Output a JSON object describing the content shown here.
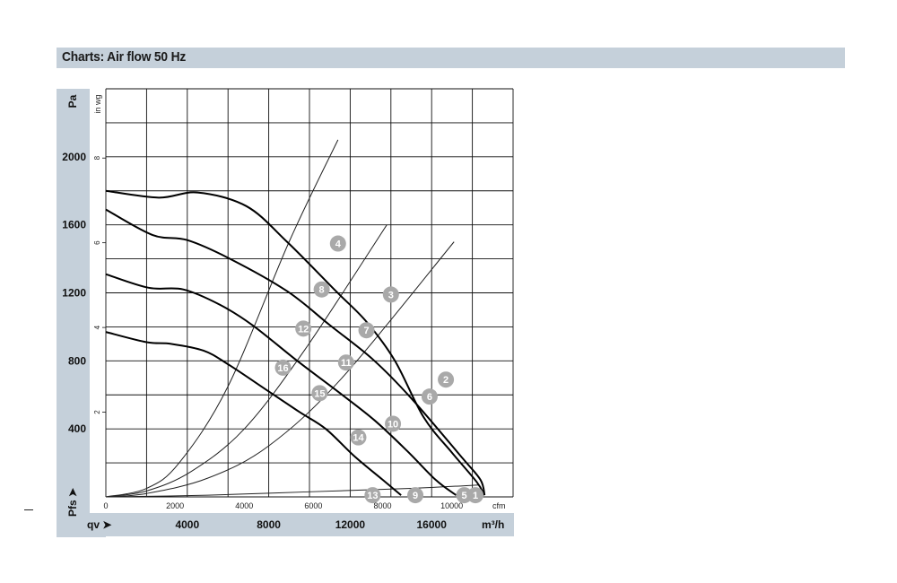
{
  "header": {
    "title": "Charts: Air flow 50 Hz"
  },
  "chart_data": {
    "type": "line",
    "title": "Charts: Air flow 50 Hz",
    "y_axes": {
      "primary": {
        "label": "Pa",
        "ticks": [
          400,
          800,
          1200,
          1600,
          2000
        ],
        "range": [
          0,
          2400
        ]
      },
      "secondary": {
        "label": "in wg",
        "ticks": [
          2,
          4,
          6,
          8
        ]
      }
    },
    "x_axes": {
      "top": {
        "label": "cfm",
        "ticks": [
          0,
          2000,
          4000,
          6000,
          8000,
          10000
        ]
      },
      "bottom": {
        "label": "m³/h",
        "ticks": [
          4000,
          8000,
          12000,
          16000
        ],
        "range": [
          0,
          20000
        ]
      }
    },
    "y_side_label": "Pfs ➤",
    "x_side_label": "qv ➤",
    "grid": true,
    "series": [
      {
        "values": [
          [
            0,
            1800
          ],
          [
            2600,
            1760
          ],
          [
            4500,
            1790
          ],
          [
            6900,
            1710
          ],
          [
            8900,
            1500
          ],
          [
            11300,
            1210
          ],
          [
            12800,
            1030
          ],
          [
            14200,
            800
          ],
          [
            15600,
            470
          ],
          [
            17000,
            260
          ],
          [
            18200,
            90
          ],
          [
            18600,
            10
          ]
        ]
      },
      {
        "values": [
          [
            0,
            1690
          ],
          [
            2300,
            1540
          ],
          [
            4000,
            1510
          ],
          [
            6100,
            1400
          ],
          [
            8900,
            1210
          ],
          [
            11000,
            1010
          ],
          [
            13100,
            810
          ],
          [
            15000,
            580
          ],
          [
            17500,
            230
          ],
          [
            18400,
            100
          ],
          [
            18600,
            10
          ]
        ]
      },
      {
        "values": [
          [
            0,
            1310
          ],
          [
            2100,
            1230
          ],
          [
            3800,
            1220
          ],
          [
            5600,
            1130
          ],
          [
            7200,
            1010
          ],
          [
            9400,
            800
          ],
          [
            11500,
            610
          ],
          [
            13200,
            450
          ],
          [
            14800,
            270
          ],
          [
            16200,
            100
          ],
          [
            17200,
            10
          ]
        ]
      },
      {
        "values": [
          [
            0,
            970
          ],
          [
            2000,
            910
          ],
          [
            3200,
            900
          ],
          [
            4800,
            860
          ],
          [
            6000,
            780
          ],
          [
            8000,
            620
          ],
          [
            9500,
            500
          ],
          [
            10800,
            400
          ],
          [
            12200,
            240
          ],
          [
            13600,
            100
          ],
          [
            14500,
            10
          ]
        ]
      }
    ],
    "operating_lines": [
      {
        "values": [
          [
            0,
            0
          ],
          [
            2000,
            50
          ],
          [
            3600,
            200
          ],
          [
            6000,
            650
          ],
          [
            9000,
            1500
          ],
          [
            11400,
            2100
          ]
        ]
      },
      {
        "values": [
          [
            0,
            0
          ],
          [
            2000,
            35
          ],
          [
            4200,
            150
          ],
          [
            6800,
            400
          ],
          [
            9800,
            870
          ],
          [
            13800,
            1600
          ]
        ]
      },
      {
        "values": [
          [
            0,
            0
          ],
          [
            2000,
            20
          ],
          [
            5000,
            110
          ],
          [
            8000,
            300
          ],
          [
            11600,
            700
          ],
          [
            17100,
            1500
          ]
        ]
      },
      {
        "values": [
          [
            0,
            0
          ],
          [
            5000,
            10
          ],
          [
            10000,
            30
          ],
          [
            15000,
            50
          ],
          [
            18300,
            70
          ]
        ]
      }
    ],
    "markers": [
      {
        "label": "1",
        "x": 18150,
        "y": 10
      },
      {
        "label": "2",
        "x": 16700,
        "y": 690
      },
      {
        "label": "3",
        "x": 14000,
        "y": 1190
      },
      {
        "label": "4",
        "x": 11400,
        "y": 1490
      },
      {
        "label": "5",
        "x": 17600,
        "y": 10
      },
      {
        "label": "6",
        "x": 15900,
        "y": 590
      },
      {
        "label": "7",
        "x": 12800,
        "y": 980
      },
      {
        "label": "8",
        "x": 10600,
        "y": 1220
      },
      {
        "label": "9",
        "x": 15200,
        "y": 10
      },
      {
        "label": "10",
        "x": 14100,
        "y": 430
      },
      {
        "label": "11",
        "x": 11800,
        "y": 790
      },
      {
        "label": "12",
        "x": 9700,
        "y": 990
      },
      {
        "label": "13",
        "x": 13100,
        "y": 10
      },
      {
        "label": "14",
        "x": 12400,
        "y": 350
      },
      {
        "label": "15",
        "x": 10500,
        "y": 610
      },
      {
        "label": "16",
        "x": 8700,
        "y": 760
      }
    ]
  }
}
